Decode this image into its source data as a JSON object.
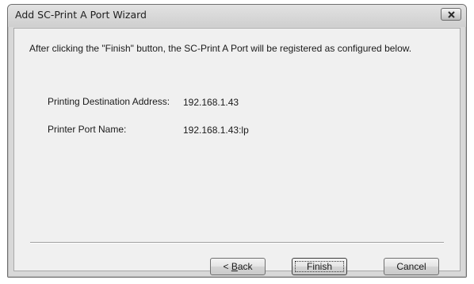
{
  "window": {
    "title": "Add SC-Print A Port Wizard",
    "close_icon": "close-icon"
  },
  "intro_text": "After clicking the \"Finish\" button, the SC-Print A Port will be registered as configured below.",
  "fields": {
    "destination_label": "Printing Destination Address:",
    "destination_value": "192.168.1.43",
    "port_name_label": "Printer Port Name:",
    "port_name_value": "192.168.1.43:lp"
  },
  "buttons": {
    "back_prefix": "< ",
    "back_mnemonic": "B",
    "back_rest": "ack",
    "finish": "Finish",
    "cancel": "Cancel"
  }
}
